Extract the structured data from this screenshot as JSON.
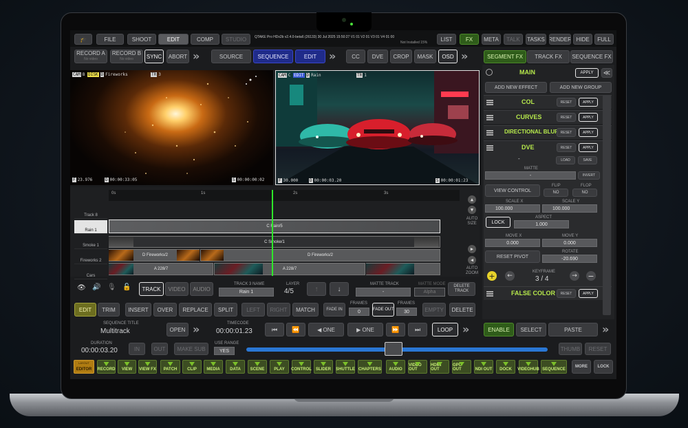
{
  "topbar": {
    "menus": [
      "FILE",
      "SHOOT",
      "EDIT",
      "COMP",
      "STUDIO"
    ],
    "info": "QTAKE Pro HDx2b v2.4.0-beta6 (26133)   30 Jul 2025 15:50:27   V1 01 V2 01 V3 01 V4 01 00",
    "info2": "Not Installed 15%",
    "right": [
      "LIST",
      "FX",
      "META",
      "TALK",
      "TASKS",
      "RENDER",
      "HIDE",
      "FULL"
    ]
  },
  "row2": {
    "record_a": "RECORD A",
    "record_a_sub": "No video",
    "record_b": "RECORD B",
    "record_b_sub": "No video",
    "sync": "SYNC",
    "abort": "ABORT",
    "source": "SOURCE",
    "sequence": "SEQUENCE",
    "edit": "EDIT",
    "cc": "CC",
    "dve": "DVE",
    "crop": "CROP",
    "mask": "MASK",
    "osd": "OSD"
  },
  "fxtabs": [
    "SEGMENT FX",
    "TRACK FX",
    "SEQUENCE FX"
  ],
  "viewer_left": {
    "cam": "CAM",
    "tag_b": "B",
    "tag_disk": "DISK",
    "tag_d": "D",
    "clip": "Fireworks",
    "tr": "TR",
    "tr_val": "3",
    "fps": "23.976",
    "tc": "00:00:33:05",
    "tc2": "00:00:00:02"
  },
  "viewer_right": {
    "cam": "CAM",
    "tag_c": "C",
    "tag_edit": "EDIT",
    "tag_d": "D",
    "clip": "Rain",
    "tr": "TR",
    "tr_val": "1",
    "fps": "30.000",
    "tc": "00:00:03.20",
    "tc2": "00:00:01:23"
  },
  "fxpanel": {
    "main": "MAIN",
    "apply": "APPLY",
    "add_effect": "ADD NEW EFFECT",
    "add_group": "ADD NEW GROUP",
    "effects": [
      {
        "name": "COL",
        "reset": "RESET",
        "apply": "APPLY"
      },
      {
        "name": "CURVES",
        "reset": "RESET",
        "apply": "APPLY"
      },
      {
        "name": "DIRECTIONAL BLUR",
        "reset": "RESET",
        "apply": "APPLY"
      },
      {
        "name": "DVE",
        "reset": "RESET",
        "apply": "APPLY"
      }
    ],
    "dash": "-",
    "load": "LOAD",
    "save": "SAVE",
    "matte": "MATTE",
    "invert": "INVERT",
    "view_control": "VIEW CONTROL",
    "flip": "FLIP",
    "flop": "FLOP",
    "no": "NO",
    "scale_x": "SCALE X",
    "scale_y": "SCALE Y",
    "scale_x_val": "100.000",
    "scale_y_val": "100.000",
    "lock": "LOCK",
    "aspect": "ASPECT",
    "aspect_val": "1.000",
    "move_x": "MOVE X",
    "move_y": "MOVE Y",
    "move_x_val": "0.000",
    "move_y_val": "0.000",
    "reset_pivot": "RESET PIVOT",
    "rotate": "ROTATE",
    "rotate_val": "-20.690",
    "keyframe": "KEYFRAME",
    "keyframe_val": "3 / 4",
    "false_color": "FALSE COLOR",
    "enable": "ENABLE",
    "select": "SELECT",
    "paste": "PASTE"
  },
  "timeline": {
    "ticks": [
      "0s",
      "1s",
      "2s",
      "3s"
    ],
    "tracks": [
      "Track 8",
      "Rain 1",
      "Smoke 1",
      "Fireworks 2",
      "Cars"
    ],
    "clips": {
      "rain": "C Rain/5",
      "smoke": "C Smoke/1",
      "fw1": "D Fireworks/2",
      "fw2": "D Fireworks/2",
      "cars1": "A 228/7",
      "cars2": "A 228/7",
      "cars3": "A 228/7"
    },
    "auto_size": "AUTO SIZE",
    "auto_zoom": "AUTO ZOOM"
  },
  "trackbar": {
    "track": "TRACK",
    "video": "VIDEO",
    "audio": "AUDIO",
    "track_name_lab": "TRACK 3 NAME",
    "track_name": "Rain 1",
    "layer_lab": "LAYER",
    "layer": "4/5",
    "matte_track_lab": "MATTE TRACK",
    "matte_track": "-",
    "matte_mode_lab": "MATTE MODE",
    "matte_mode": "Alpha",
    "delete_track": "DELETE TRACK"
  },
  "editbar": {
    "edit": "EDIT",
    "trim": "TRIM",
    "insert": "INSERT",
    "over": "OVER",
    "replace": "REPLACE",
    "split": "SPLIT",
    "left": "LEFT",
    "right": "RIGHT",
    "match": "MATCH",
    "fade_in": "FADE IN",
    "frames_lab": "FRAMES",
    "frames1": "0",
    "fade_out": "FADE OUT",
    "frames2": "30",
    "empty": "EMPTY",
    "delete": "DELETE"
  },
  "seqbar": {
    "seq_title_lab": "SEQUENCE TITLE",
    "seq_title": "Multitrack",
    "open": "OPEN",
    "tc_lab": "TIMECODE",
    "tc": "00:00:01.23",
    "one_left": "ONE",
    "one_right": "ONE",
    "loop": "LOOP"
  },
  "durbar": {
    "dur_lab": "DURATION",
    "dur": "00:00:03.20",
    "in": "IN",
    "out": "OUT",
    "make_sub": "MAKE SUB",
    "use_range_lab": "USE RANGE",
    "use_range": "YES",
    "thumb": "THUMB",
    "reset": "RESET"
  },
  "bottombar": {
    "layout": "LAYOUT",
    "editor": "EDITOR",
    "items": [
      "RECORD",
      "VIEW",
      "VIEW FX",
      "PATCH",
      "CLIP",
      "MEDIA",
      "DATA",
      "SCENE",
      "PLAY",
      "CONTROL",
      "SLIDER",
      "SHUTTLE",
      "CHAPTERS",
      "AUDIO",
      "VIDEO OUT",
      "HDMI OUT",
      "GPU OUT",
      "NDI OUT",
      "DOCK",
      "VIDEOHUB",
      "SEQUENCE"
    ],
    "more": "MORE",
    "lock": "LOCK"
  }
}
